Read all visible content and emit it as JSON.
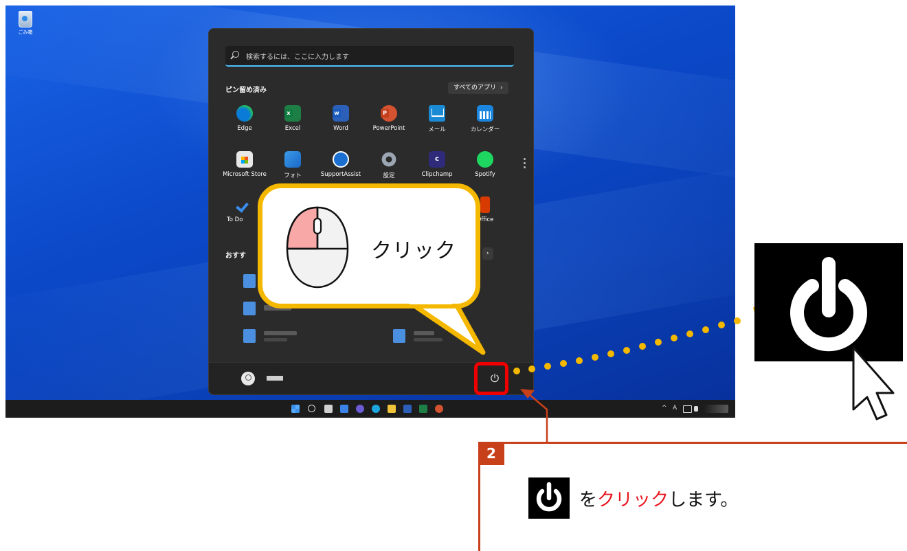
{
  "desktop": {
    "recycle_bin_label": "ごみ箱"
  },
  "start_menu": {
    "search_placeholder": "検索するには、ここに入力します",
    "pinned_title": "ピン留め済み",
    "all_apps_label": "すべてのアプリ",
    "pinned_apps": [
      {
        "label": "Edge",
        "icon": "edge-icon"
      },
      {
        "label": "Excel",
        "icon": "excel-icon"
      },
      {
        "label": "Word",
        "icon": "word-icon"
      },
      {
        "label": "PowerPoint",
        "icon": "powerpoint-icon"
      },
      {
        "label": "メール",
        "icon": "mail-icon"
      },
      {
        "label": "カレンダー",
        "icon": "calendar-icon"
      },
      {
        "label": "Microsoft Store",
        "icon": "store-icon"
      },
      {
        "label": "フォト",
        "icon": "photos-icon"
      },
      {
        "label": "SupportAssist",
        "icon": "supportassist-icon"
      },
      {
        "label": "設定",
        "icon": "settings-icon"
      },
      {
        "label": "Clipchamp",
        "icon": "clipchamp-icon"
      },
      {
        "label": "Spotify",
        "icon": "spotify-icon"
      },
      {
        "label": "To Do",
        "icon": "todo-icon"
      },
      {
        "label": "Office",
        "icon": "office-icon"
      }
    ],
    "recommended_title": "おすす"
  },
  "callout": {
    "text": "クリック"
  },
  "step": {
    "number": "2",
    "text_prefix": "を",
    "text_highlight": "クリック",
    "text_suffix": "します。"
  },
  "colors": {
    "accent_orange": "#f5b800",
    "highlight_red": "#ee0000",
    "step_brown": "#c8401a"
  }
}
